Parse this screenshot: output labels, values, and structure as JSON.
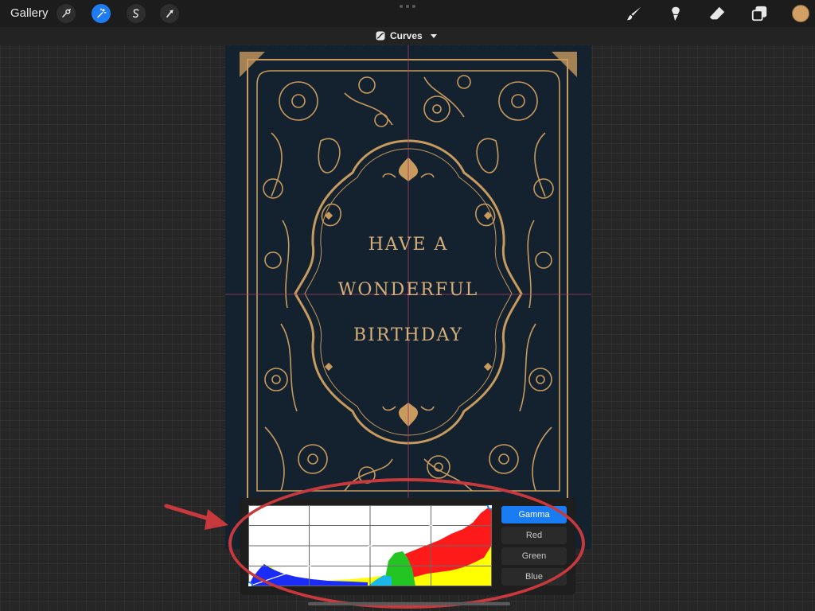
{
  "toolbar": {
    "gallery_label": "Gallery",
    "left_tools": [
      {
        "name": "wrench-icon",
        "active": false
      },
      {
        "name": "magic-wand-icon",
        "active": true
      },
      {
        "name": "selection-s-icon",
        "active": false
      },
      {
        "name": "transform-arrow-icon",
        "active": false
      }
    ],
    "right_tools": [
      "brush-icon",
      "smudge-icon",
      "eraser-icon",
      "layers-icon"
    ],
    "current_color": "#d2a066"
  },
  "adjustment": {
    "title": "Curves",
    "icon": "curves-icon"
  },
  "card": {
    "line1": "HAVE A",
    "line2": "WONDERFUL",
    "line3": "BIRTHDAY",
    "background": "#13222e",
    "gold": "#c89a5e"
  },
  "annotation": {
    "color": "#c8393d"
  },
  "curves": {
    "channels": [
      "Gamma",
      "Red",
      "Green",
      "Blue"
    ],
    "active_channel": "Gamma",
    "points": [
      [
        0,
        0
      ],
      [
        1,
        1
      ]
    ],
    "accent": "#1a7cf2"
  }
}
